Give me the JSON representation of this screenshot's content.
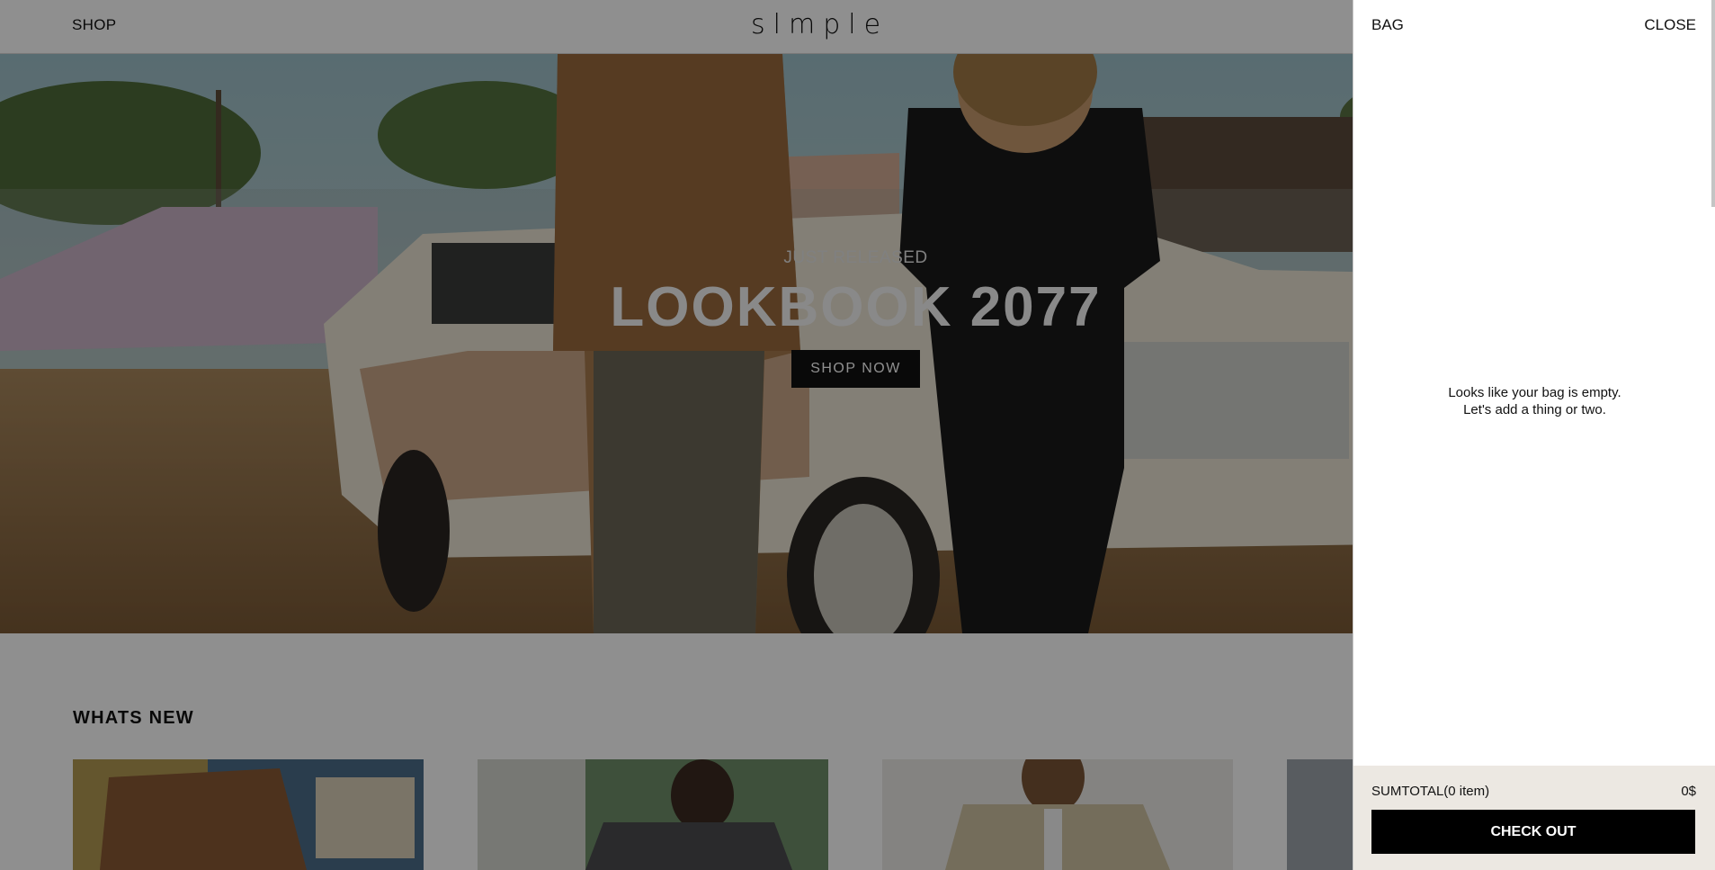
{
  "header": {
    "nav_shop": "SHOP",
    "logo": "slmple"
  },
  "hero": {
    "kicker": "JUST RELEASED",
    "title": "LOOKBOOK 2077",
    "button": "SHOP NOW"
  },
  "whats_new": {
    "title": "WHATS NEW"
  },
  "bag": {
    "title": "BAG",
    "close": "CLOSE",
    "empty_line1": "Looks like your bag is empty.",
    "empty_line2": "Let's add a thing or two.",
    "subtotal_label": "SUMTOTAL(0 item)",
    "subtotal_value": "0$",
    "checkout": "CHECK OUT"
  },
  "colors": {
    "overlay": "rgba(0,0,0,0.44)",
    "drawer_footer": "#ece8e2",
    "button_bg": "#000000"
  }
}
